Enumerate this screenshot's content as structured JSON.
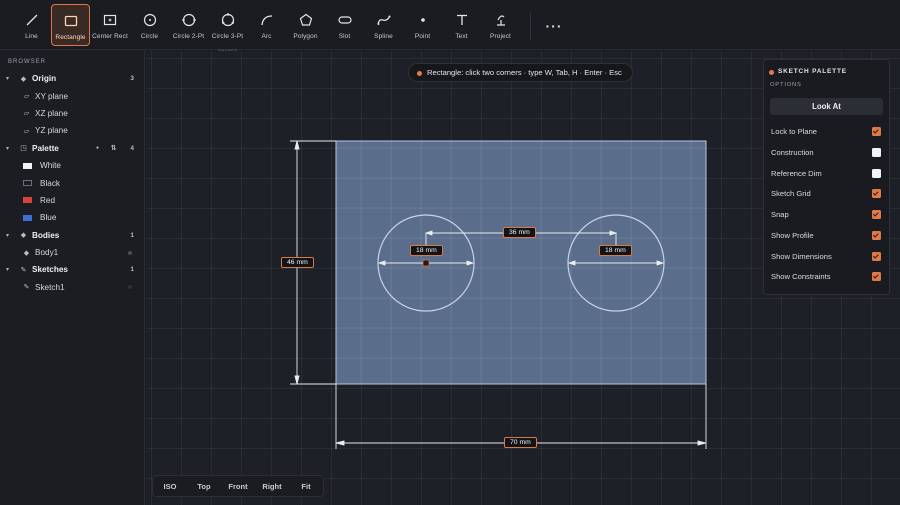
{
  "toolbar": {
    "tools": [
      {
        "label": "Line",
        "icon": "line-icon"
      },
      {
        "label": "Rectangle",
        "icon": "rectangle-icon",
        "active": true
      },
      {
        "label": "Center Rect",
        "icon": "center-rect-icon"
      },
      {
        "label": "Circle",
        "icon": "circle-icon"
      },
      {
        "label": "Circle 2-Pt",
        "icon": "circle-2pt-icon"
      },
      {
        "label": "Circle 3-Pt",
        "icon": "circle-3pt-icon"
      },
      {
        "label": "Arc",
        "icon": "arc-icon"
      },
      {
        "label": "Polygon",
        "icon": "polygon-icon"
      },
      {
        "label": "Slot",
        "icon": "slot-icon"
      },
      {
        "label": "Spline",
        "icon": "spline-icon"
      },
      {
        "label": "Point",
        "icon": "point-icon"
      },
      {
        "label": "Text",
        "icon": "text-icon"
      },
      {
        "label": "Project",
        "icon": "project-icon"
      }
    ],
    "more_label": "···",
    "group_tag": "SHAPES",
    "accent": "#e0794a"
  },
  "browser": {
    "title": "BROWSER",
    "origin": {
      "label": "Origin",
      "count": "3",
      "items": [
        "XY plane",
        "XZ plane",
        "YZ plane"
      ]
    },
    "palette": {
      "label": "Palette",
      "count": "4",
      "items": [
        {
          "label": "White",
          "color": "#f2f3f5"
        },
        {
          "label": "Black",
          "color": "#1a1c21"
        },
        {
          "label": "Red",
          "color": "#d8443c"
        },
        {
          "label": "Blue",
          "color": "#3f6ed6"
        }
      ]
    },
    "bodies": {
      "label": "Bodies",
      "count": "1",
      "items": [
        "Body1"
      ]
    },
    "sketches": {
      "label": "Sketches",
      "count": "1",
      "items": [
        "Sketch1"
      ]
    }
  },
  "hint": {
    "text": "Rectangle: click two corners · type W, Tab, H · Enter · Esc"
  },
  "sketch_palette": {
    "title": "SKETCH PALETTE",
    "subtitle": "OPTIONS",
    "look_at_label": "Look At",
    "options": [
      {
        "label": "Lock to Plane",
        "checked": true
      },
      {
        "label": "Construction",
        "checked": false
      },
      {
        "label": "Reference Dim",
        "checked": false
      },
      {
        "label": "Sketch Grid",
        "checked": true
      },
      {
        "label": "Snap",
        "checked": true
      },
      {
        "label": "Show Profile",
        "checked": true
      },
      {
        "label": "Show Dimensions",
        "checked": true
      },
      {
        "label": "Show Constraints",
        "checked": true
      }
    ]
  },
  "dimensions": {
    "height": "46 mm",
    "width": "70 mm",
    "spacing": "36 mm",
    "left_diameter": "18 mm",
    "right_diameter": "18 mm"
  },
  "view_bar": {
    "buttons": [
      "ISO",
      "Top",
      "Front",
      "Right",
      "Fit"
    ]
  }
}
